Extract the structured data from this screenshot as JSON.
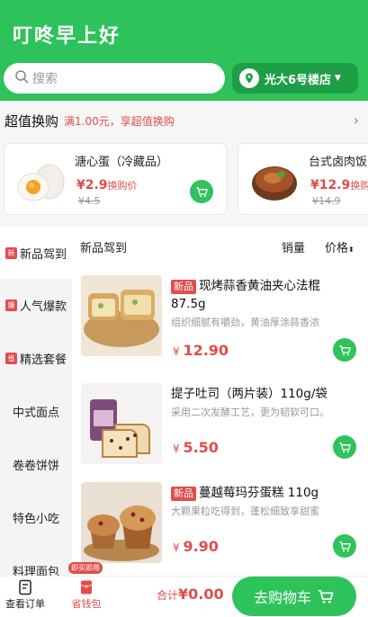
{
  "header": {
    "brand": "叮咚早上好",
    "search_placeholder": "搜索",
    "store": "光大6号楼店"
  },
  "swap": {
    "title": "超值换购",
    "subtitle": "满1.00元，享超值换购"
  },
  "promos": [
    {
      "name": "溏心蛋（冷藏品）",
      "price": "¥2.9",
      "price_note": "换购价",
      "old": "¥4.5"
    },
    {
      "name": "台式卤肉饭",
      "price": "¥12.9",
      "price_note": "换购价",
      "old": "¥14.9"
    }
  ],
  "sidebar": {
    "items": [
      {
        "label": "新品驾到",
        "tag": "新"
      },
      {
        "label": "人气爆款",
        "tag": "爆"
      },
      {
        "label": "精选套餐",
        "tag": "省"
      },
      {
        "label": "中式面点",
        "tag": ""
      },
      {
        "label": "卷卷饼饼",
        "tag": ""
      },
      {
        "label": "特色小吃",
        "tag": ""
      },
      {
        "label": "料理面包",
        "tag": ""
      }
    ]
  },
  "list": {
    "category": "新品驾到",
    "sort_sales": "销量",
    "sort_price": "价格",
    "products": [
      {
        "badge": "新品",
        "name": "现烤蒜香黄油夹心法棍 87.5g",
        "desc": "组织细腻有嚼劲，黄油厚涂蒜香浓",
        "price": "12.90"
      },
      {
        "badge": "",
        "name": "提子吐司（两片装）110g/袋",
        "desc": "采用二次发酵工艺，更为韧软可口。",
        "price": "5.50"
      },
      {
        "badge": "新品",
        "name": "蔓越莓玛芬蛋糕 110g",
        "desc": "大颗果粒吃得到，蓬松细致享甜蜜",
        "price": "9.90"
      }
    ]
  },
  "bottom": {
    "orders": "查看订单",
    "wallet": "省钱包",
    "wallet_badge": "即买即用",
    "total_label": "合计",
    "total_value": "¥0.00",
    "checkout": "去购物车"
  },
  "colors": {
    "brand_green": "#2dc25a",
    "accent_red": "#e14c4c"
  }
}
